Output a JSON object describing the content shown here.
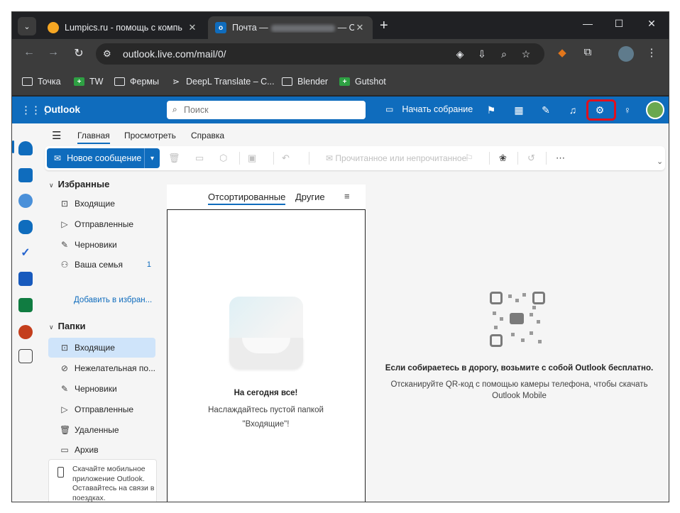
{
  "browser": {
    "tabs": [
      {
        "title": "Lumpics.ru - помощь с компь",
        "favicon": "lumpics-icon"
      },
      {
        "title_prefix": "Почта —",
        "title_suffix": "— Ou",
        "favicon": "outlook-icon"
      }
    ],
    "url": "outlook.live.com/mail/0/",
    "bookmarks": [
      {
        "label": "Точка",
        "icon": "folder-icon"
      },
      {
        "label": "TW",
        "icon": "green-plus-icon"
      },
      {
        "label": "Фермы",
        "icon": "folder-icon"
      },
      {
        "label": "DeepL Translate – C...",
        "icon": "deepl-icon"
      },
      {
        "label": "Blender",
        "icon": "folder-icon"
      },
      {
        "label": "Gutshot",
        "icon": "green-plus-icon"
      }
    ]
  },
  "header": {
    "app_name": "Outlook",
    "search_placeholder": "Поиск",
    "meeting_label": "Начать собрание",
    "accent_color": "#0f6cbd",
    "highlight_color": "#e0101e"
  },
  "ribbon": {
    "tabs": [
      "Главная",
      "Просмотреть",
      "Справка"
    ],
    "new_message": "Новое сообщение",
    "read_unread": "Прочитанное или непрочитанное"
  },
  "folders": {
    "favorites_title": "Избранные",
    "favorites": [
      {
        "label": "Входящие",
        "icon": "inbox-icon"
      },
      {
        "label": "Отправленные",
        "icon": "send-icon"
      },
      {
        "label": "Черновики",
        "icon": "draft-icon"
      },
      {
        "label": "Ваша семья",
        "icon": "family-icon",
        "count": "1"
      }
    ],
    "add_favorite": "Добавить в избран...",
    "folders_title": "Папки",
    "items": [
      {
        "label": "Входящие",
        "icon": "inbox-icon",
        "selected": true
      },
      {
        "label": "Нежелательная по...",
        "icon": "junk-icon"
      },
      {
        "label": "Черновики",
        "icon": "draft-icon"
      },
      {
        "label": "Отправленные",
        "icon": "send-icon"
      },
      {
        "label": "Удаленные",
        "icon": "trash-icon"
      },
      {
        "label": "Архив",
        "icon": "archive-icon"
      }
    ],
    "mobile_promo": "Скачайте мобильное приложение Outlook. Оставайтесь на связи в поездках."
  },
  "message_list": {
    "tab_focused": "Отсортированные",
    "tab_other": "Другие",
    "empty_title": "На сегодня все!",
    "empty_subtitle": "Наслаждайтесь пустой папкой \"Входящие\"!"
  },
  "reading_pane": {
    "qr_title": "Если собираетесь в дорогу, возьмите с собой Outlook бесплатно.",
    "qr_subtitle": "Отсканируйте QR-код с помощью камеры телефона, чтобы скачать Outlook Mobile"
  }
}
